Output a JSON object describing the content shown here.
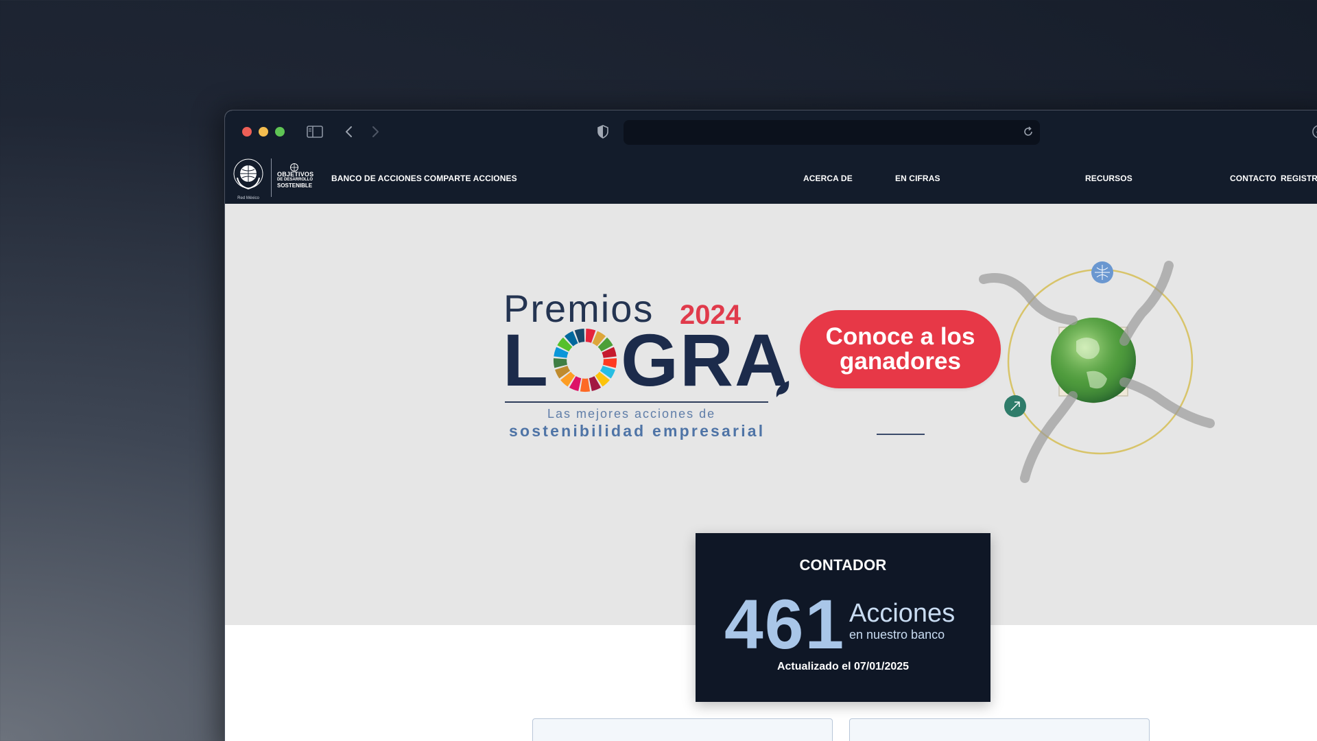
{
  "browser": {
    "url": "",
    "icons": [
      "sidebar-icon",
      "back-icon",
      "forward-icon",
      "shield-icon",
      "reload-icon",
      "download-icon"
    ]
  },
  "site_nav": {
    "logo_un_text": "Red México",
    "logo_ods_line1": "OBJETIVOS",
    "logo_ods_line2": "DE DESARROLLO",
    "logo_ods_line3": "SOSTENIBLE",
    "items": [
      {
        "label": "BANCO DE ACCIONES"
      },
      {
        "label": "COMPARTE ACCIONES"
      },
      {
        "label": "ACERCA DE"
      },
      {
        "label": "EN CIFRAS"
      },
      {
        "label": "RECURSOS"
      },
      {
        "label": "CONTACTO"
      },
      {
        "label": "REGISTR"
      }
    ]
  },
  "hero": {
    "premios": "Premios",
    "year": "2024",
    "logra_l": "L",
    "logra_rest": "GRA",
    "tagline1": "Las mejores acciones de",
    "tagline2": "sostenibilidad empresarial",
    "cta_line1": "Conoce a los",
    "cta_line2": "ganadores"
  },
  "counter": {
    "title": "CONTADOR",
    "number": "461",
    "label_main": "Acciones",
    "label_sub": "en nuestro banco",
    "updated": "Actualizado el 07/01/2025"
  },
  "colors": {
    "nav_bg": "#131c2b",
    "hero_bg": "#e6e6e6",
    "cta": "#e73847",
    "counter_bg": "#0f1726",
    "counter_number": "#a9c6e8"
  }
}
